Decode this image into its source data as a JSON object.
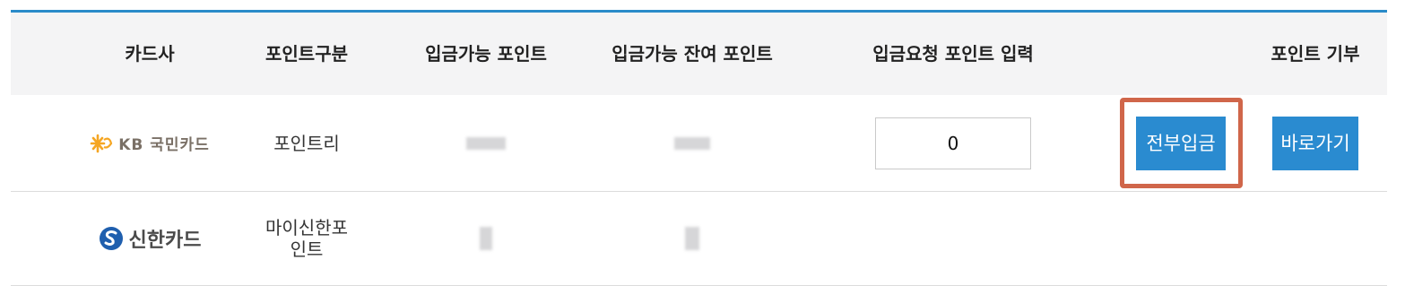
{
  "table": {
    "headers": [
      "카드사",
      "포인트구분",
      "입금가능 포인트",
      "입금가능 잔여 포인트",
      "입금요청 포인트 입력",
      "포인트 기부"
    ],
    "rows": [
      {
        "card_company": "KB국민카드",
        "card_logo_text": "KB 국민카드",
        "point_type": "포인트리",
        "input_value": "0",
        "deposit_all_label": "전부입금",
        "goto_label": "바로가기"
      },
      {
        "card_company": "신한카드",
        "card_logo_text": "신한카드",
        "point_type_line1": "마이신한포",
        "point_type_line2": "인트"
      }
    ]
  },
  "colors": {
    "accent": "#2a8bd0",
    "header_bg": "#f4f4f5",
    "highlight": "#d0664a"
  }
}
